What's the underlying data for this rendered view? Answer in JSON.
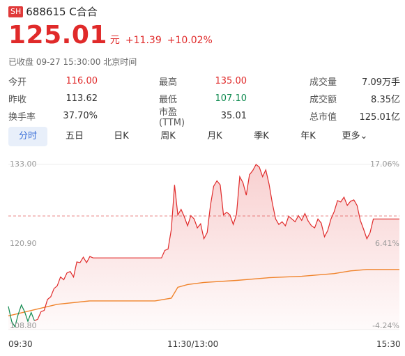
{
  "header": {
    "market_badge": "SH",
    "title": "688615 C合合"
  },
  "price": {
    "current": "125.01",
    "unit": "元",
    "change": "+11.39",
    "change_pct": "+10.02%"
  },
  "status": "已收盘 09-27 15:30:00 北京时间",
  "stats": {
    "open_label": "今开",
    "open": "116.00",
    "high_label": "最高",
    "high": "135.00",
    "volume_label": "成交量",
    "volume": "7.09万手",
    "prev_close_label": "昨收",
    "prev_close": "113.62",
    "low_label": "最低",
    "low": "107.10",
    "amount_label": "成交额",
    "amount": "8.35亿",
    "turnover_label": "换手率",
    "turnover": "37.70%",
    "pe_label": "市盈(TTM)",
    "pe": "35.01",
    "mcap_label": "总市值",
    "mcap": "125.01亿"
  },
  "tabs": [
    {
      "label": "分时",
      "active": true
    },
    {
      "label": "五日"
    },
    {
      "label": "日K"
    },
    {
      "label": "周K"
    },
    {
      "label": "月K"
    },
    {
      "label": "季K"
    },
    {
      "label": "年K"
    },
    {
      "label": "更多"
    }
  ],
  "colors": {
    "up": "#e02a2a",
    "down": "#0e8a4f",
    "avg": "#f0842c",
    "accent": "#3a6fd8"
  },
  "chart_data": {
    "type": "line",
    "ylim": [
      108.8,
      133.0
    ],
    "y_tick_labels": [
      "133.00",
      "120.90",
      "108.80"
    ],
    "pct_tick_labels": [
      "17.06%",
      "6.41%",
      "-4.24%"
    ],
    "x_tick_labels": [
      "09:30",
      "11:30/13:00",
      "15:30"
    ],
    "prev_close": 113.62,
    "series": [
      {
        "x": [
          0,
          2,
          4,
          6,
          8,
          10,
          12,
          14,
          16,
          18,
          20,
          22,
          24,
          26,
          28,
          30,
          32,
          34,
          36,
          38,
          40,
          42,
          44,
          46,
          48,
          50,
          52,
          54,
          56,
          58,
          60,
          62,
          64,
          66,
          68,
          70,
          72,
          74,
          76,
          78,
          80,
          82,
          84,
          86,
          88,
          90,
          92,
          94,
          96,
          98,
          100,
          102,
          104,
          106,
          108,
          110,
          112,
          114,
          116,
          118,
          120,
          122,
          124,
          126,
          128,
          130,
          132,
          134,
          136,
          138,
          140,
          142,
          144,
          146,
          148,
          150,
          152,
          154,
          156,
          158,
          160,
          162,
          164,
          166,
          168,
          170,
          172,
          174,
          176,
          178,
          180,
          182,
          184,
          186,
          188,
          190,
          192,
          194,
          196,
          198,
          200,
          202,
          204,
          206,
          208,
          210,
          212,
          214,
          216,
          218,
          220,
          222,
          224,
          226,
          228,
          230,
          232,
          234,
          236,
          238,
          240
        ],
        "values": [
          112.2,
          110.0,
          109.2,
          111.0,
          112.4,
          111.4,
          110.0,
          111.3,
          110.1,
          110.3,
          111.4,
          111.6,
          113.2,
          113.6,
          114.8,
          115.2,
          116.5,
          116.1,
          117.1,
          117.3,
          116.5,
          118.7,
          118.6,
          119.4,
          118.6,
          119.5,
          119.3,
          119.3,
          119.3,
          119.3,
          119.3,
          119.3,
          119.3,
          119.3,
          119.3,
          119.3,
          119.3,
          119.3,
          119.3,
          119.3,
          119.3,
          119.3,
          119.3,
          119.3,
          119.3,
          119.3,
          119.3,
          119.3,
          120.4,
          120.6,
          123.5,
          130.0,
          125.6,
          126.4,
          125.3,
          124.0,
          125.5,
          125.0,
          123.7,
          124.3,
          122.1,
          123.0,
          127.0,
          129.8,
          130.6,
          130.0,
          125.6,
          126.0,
          125.6,
          124.2,
          125.7,
          131.2,
          130.3,
          128.5,
          131.5,
          132.1,
          133.0,
          132.6,
          131.2,
          132.2,
          130.1,
          127.3,
          125.0,
          124.2,
          124.6,
          124.0,
          125.4,
          125.0,
          124.6,
          125.5,
          124.8,
          125.8,
          124.7,
          124.0,
          123.7,
          125.0,
          124.4,
          122.4,
          123.3,
          125.0,
          126.1,
          127.7,
          127.5,
          128.2,
          127.0,
          127.6,
          127.8,
          127.0,
          124.8,
          123.5,
          122.1,
          123.0,
          125.0,
          125.0,
          125.0,
          125.0,
          125.0,
          125.0,
          125.0,
          125.0,
          125.0
        ]
      },
      {
        "x": [
          0,
          30,
          50,
          90,
          100,
          104,
          110,
          120,
          140,
          160,
          180,
          200,
          210,
          220,
          230,
          240
        ],
        "values": [
          110.8,
          112.5,
          113.0,
          113.0,
          113.4,
          115.0,
          115.4,
          115.7,
          116.0,
          116.4,
          116.6,
          117.0,
          117.4,
          117.6,
          117.6,
          117.6
        ]
      }
    ]
  }
}
